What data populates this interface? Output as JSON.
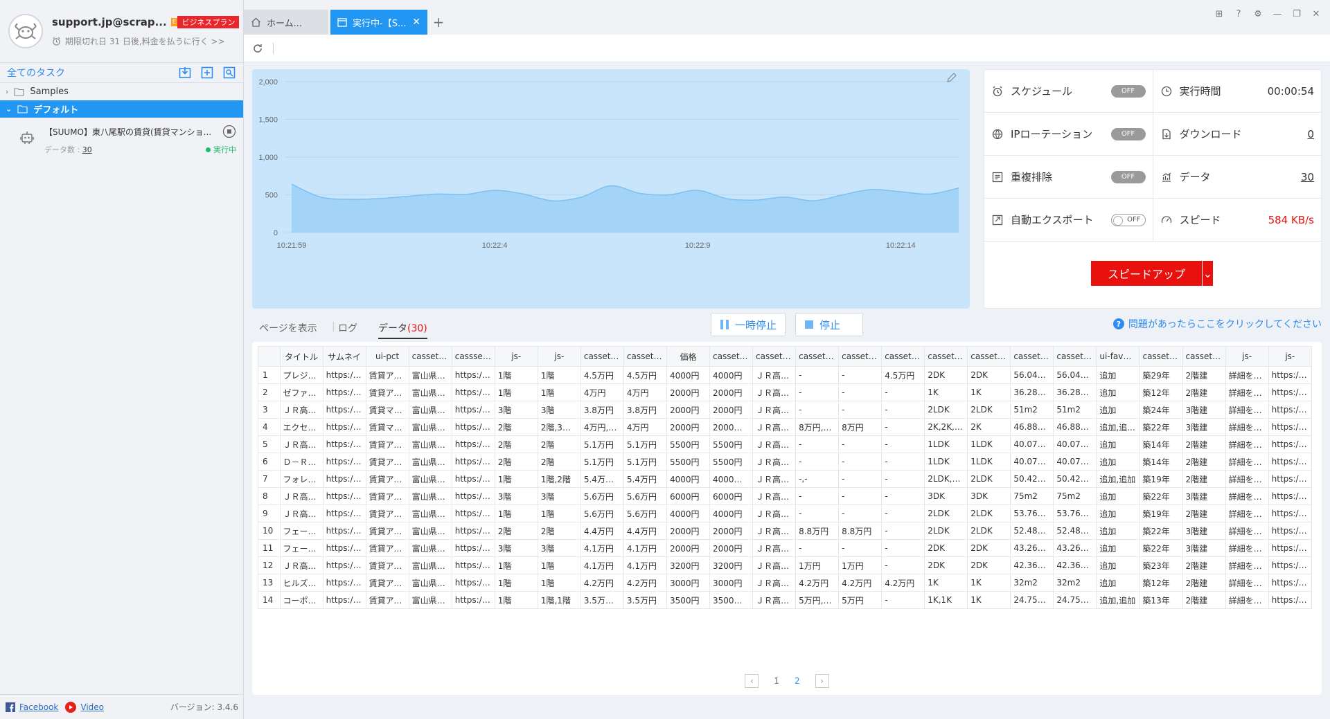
{
  "account": {
    "email": "support.jp@scrap...",
    "plan_badge": "E",
    "plan_label": "ビジネスプラン",
    "expiry_text": "期限切れ日 31 日後,料金を払うに行く >>"
  },
  "sidebar": {
    "all_tasks_label": "全てのタスク",
    "folders": [
      {
        "label": "Samples",
        "expanded": false,
        "selected": false
      },
      {
        "label": "デフォルト",
        "expanded": true,
        "selected": true
      }
    ],
    "task": {
      "title": "【SUUMO】東八尾駅の賃貸(賃貸マンショ...",
      "data_count_label": "データ数 :",
      "data_count": "30",
      "status": "実行中"
    },
    "footer": {
      "facebook": "Facebook",
      "video": "Video",
      "version": "バージョン: 3.4.6"
    }
  },
  "tabs": [
    {
      "label": "ホーム...",
      "active": false
    },
    {
      "label": "実行中-【S...",
      "active": true
    }
  ],
  "window_controls": [
    "gift-icon",
    "help-icon",
    "settings-icon",
    "minimize-icon",
    "restore-icon",
    "close-icon"
  ],
  "chart_data": {
    "type": "area",
    "title": "",
    "xlabel": "",
    "ylabel": "",
    "ylim": [
      0,
      2000
    ],
    "yticks": [
      "0",
      "500",
      "1,000",
      "1,500",
      "2,000"
    ],
    "xticks": [
      "10:21:59",
      "10:22:4",
      "10:22:9",
      "10:22:14"
    ],
    "x": [
      0,
      1,
      2,
      3,
      4,
      5,
      6,
      7,
      8,
      9,
      10,
      11,
      12,
      13,
      14,
      15,
      16,
      17,
      18,
      19,
      20,
      21,
      22,
      23
    ],
    "values": [
      640,
      470,
      440,
      450,
      480,
      510,
      505,
      560,
      510,
      420,
      470,
      620,
      520,
      500,
      560,
      450,
      430,
      470,
      420,
      500,
      570,
      540,
      510,
      590
    ],
    "colors": {
      "fill": "#9fd2f7",
      "line": "#7cc0f2",
      "background": "#c8e5fb"
    }
  },
  "stats": {
    "schedule": {
      "label": "スケジュール",
      "state": "OFF"
    },
    "runtime": {
      "label": "実行時間",
      "value": "00:00:54"
    },
    "ip_rotation": {
      "label": "IPローテーション",
      "state": "OFF"
    },
    "download": {
      "label": "ダウンロード",
      "value": "0"
    },
    "dedupe": {
      "label": "重複排除",
      "state": "OFF"
    },
    "data": {
      "label": "データ",
      "value": "30"
    },
    "auto_export": {
      "label": "自動エクスポート",
      "state": "OFF"
    },
    "speed": {
      "label": "スピード",
      "value": "584 KB/s",
      "color": "#e8110d"
    },
    "speedup_button": "スピードアップ"
  },
  "data_tabs": {
    "show_page": "ページを表示",
    "log": "ログ",
    "data_label": "データ",
    "data_count": "(30)",
    "pause_button": "一時停止",
    "stop_button": "停止",
    "help_text": "問題があったらここをクリックしてください"
  },
  "table": {
    "columns": [
      "",
      "タイトル",
      "サムネイ",
      "ui-pct",
      "cassette...",
      "cassset...",
      "js-",
      "js-",
      "cassette...",
      "cassette...",
      "価格",
      "cassette...",
      "cassette...",
      "cassette...",
      "cassette...",
      "cassette...",
      "cassette...",
      "cassette...",
      "cassette...",
      "cassette...",
      "ui-favorite",
      "cassette...",
      "cassette...",
      "js-",
      "js-"
    ],
    "rows": [
      [
        "1",
        "プレジー...",
        "https://im...",
        "賃貸アパ...",
        "富山県富...",
        "https://im...",
        "1階",
        "1階",
        "4.5万円",
        "4.5万円",
        "4000円",
        "4000円",
        "ＪＲ高山...",
        "-",
        "-",
        "4.5万円",
        "2DK",
        "2DK",
        "56.04m2",
        "56.04m2",
        "追加",
        "築29年",
        "2階建",
        "詳細を見...",
        "https://su..."
      ],
      [
        "2",
        "ゼファー...",
        "https://im...",
        "賃貸アパ...",
        "富山県富...",
        "https://im...",
        "1階",
        "1階",
        "4万円",
        "4万円",
        "2000円",
        "2000円",
        "ＪＲ高山...",
        "-",
        "-",
        "-",
        "1K",
        "1K",
        "36.28m2",
        "36.28m2",
        "追加",
        "築12年",
        "2階建",
        "詳細を見...",
        "https://su..."
      ],
      [
        "3",
        "ＪＲ高山...",
        "https://im...",
        "賃貸マン...",
        "富山県富...",
        "https://im...",
        "3階",
        "3階",
        "3.8万円",
        "3.8万円",
        "2000円",
        "2000円",
        "ＪＲ高山...",
        "-",
        "-",
        "-",
        "2LDK",
        "2LDK",
        "51m2",
        "51m2",
        "追加",
        "築24年",
        "3階建",
        "詳細を見...",
        "https://su..."
      ],
      [
        "4",
        "エクセル...",
        "https://im...",
        "賃貸マン...",
        "富山県富...",
        "https://im...",
        "2階",
        "2階,3階,...",
        "4万円,4....",
        "4万円",
        "2000円",
        "2000円,...",
        "ＪＲ高山...",
        "8万円,8....",
        "8万円",
        "-",
        "2K,2K,2...",
        "2K",
        "46.88m2,...",
        "46.88m2",
        "追加,追...",
        "築22年",
        "3階建",
        "詳細を見...",
        "https://su..."
      ],
      [
        "5",
        "ＪＲ高山...",
        "https://im...",
        "賃貸アパ...",
        "富山県富...",
        "https://im...",
        "2階",
        "2階",
        "5.1万円",
        "5.1万円",
        "5500円",
        "5500円",
        "ＪＲ高山...",
        "-",
        "-",
        "-",
        "1LDK",
        "1LDK",
        "40.07m2",
        "40.07m2",
        "追加",
        "築14年",
        "2階建",
        "詳細を見...",
        "https://su..."
      ],
      [
        "6",
        "Ｄ－Ｒｏ...",
        "https://im...",
        "賃貸アパ...",
        "富山県富...",
        "https://im...",
        "2階",
        "2階",
        "5.1万円",
        "5.1万円",
        "5500円",
        "5500円",
        "ＪＲ高山...",
        "-",
        "-",
        "-",
        "1LDK",
        "1LDK",
        "40.07m2",
        "40.07m2",
        "追加",
        "築14年",
        "2階建",
        "詳細を見...",
        "https://su..."
      ],
      [
        "7",
        "フォレス...",
        "https://im...",
        "賃貸アパ...",
        "富山県富...",
        "https://im...",
        "1階",
        "1階,2階",
        "5.4万円,...",
        "5.4万円",
        "4000円",
        "4000円,...",
        "ＪＲ高山...",
        "-,-",
        "-",
        "-",
        "2LDK,2...",
        "2LDK",
        "50.42m2...",
        "50.42m2",
        "追加,追加",
        "築19年",
        "2階建",
        "詳細を見...",
        "https://su..."
      ],
      [
        "8",
        "ＪＲ高山...",
        "https://im...",
        "賃貸アパ...",
        "富山県富...",
        "https://im...",
        "3階",
        "3階",
        "5.6万円",
        "5.6万円",
        "6000円",
        "6000円",
        "ＪＲ高山...",
        "-",
        "-",
        "-",
        "3DK",
        "3DK",
        "75m2",
        "75m2",
        "追加",
        "築22年",
        "3階建",
        "詳細を見...",
        "https://su..."
      ],
      [
        "9",
        "ＪＲ高山...",
        "https://im...",
        "賃貸アパ...",
        "富山県富...",
        "https://im...",
        "1階",
        "1階",
        "5.6万円",
        "5.6万円",
        "4000円",
        "4000円",
        "ＪＲ高山...",
        "-",
        "-",
        "-",
        "2LDK",
        "2LDK",
        "53.76m2",
        "53.76m2",
        "追加",
        "築19年",
        "2階建",
        "詳細を見...",
        "https://su..."
      ],
      [
        "10",
        "フェール...",
        "https://im...",
        "賃貸アパ...",
        "富山県富...",
        "https://im...",
        "2階",
        "2階",
        "4.4万円",
        "4.4万円",
        "2000円",
        "2000円",
        "ＪＲ高山...",
        "8.8万円",
        "8.8万円",
        "-",
        "2LDK",
        "2LDK",
        "52.48m2",
        "52.48m2",
        "追加",
        "築22年",
        "3階建",
        "詳細を見...",
        "https://su..."
      ],
      [
        "11",
        "フェール...",
        "https://im...",
        "賃貸アパ...",
        "富山県富...",
        "https://im...",
        "3階",
        "3階",
        "4.1万円",
        "4.1万円",
        "2000円",
        "2000円",
        "ＪＲ高山...",
        "-",
        "-",
        "-",
        "2DK",
        "2DK",
        "43.26m2",
        "43.26m2",
        "追加",
        "築22年",
        "3階建",
        "詳細を見...",
        "https://su..."
      ],
      [
        "12",
        "ＪＲ高山...",
        "https://im...",
        "賃貸アパ...",
        "富山県富...",
        "https://im...",
        "1階",
        "1階",
        "4.1万円",
        "4.1万円",
        "3200円",
        "3200円",
        "ＪＲ高山...",
        "1万円",
        "1万円",
        "-",
        "2DK",
        "2DK",
        "42.36m2",
        "42.36m2",
        "追加",
        "築23年",
        "2階建",
        "詳細を見...",
        "https://su..."
      ],
      [
        "13",
        "ヒルズ杉...",
        "https://im...",
        "賃貸アパ...",
        "富山県富...",
        "https://im...",
        "1階",
        "1階",
        "4.2万円",
        "4.2万円",
        "3000円",
        "3000円",
        "ＪＲ高山...",
        "4.2万円",
        "4.2万円",
        "4.2万円",
        "1K",
        "1K",
        "32m2",
        "32m2",
        "追加",
        "築12年",
        "2階建",
        "詳細を見...",
        "https://su..."
      ],
      [
        "14",
        "コーポ・...",
        "https://im...",
        "賃貸アパ...",
        "富山県富...",
        "https://im...",
        "1階",
        "1階,1階",
        "3.5万円,...",
        "3.5万円",
        "3500円",
        "3500円,...",
        "ＪＲ高山...",
        "5万円,5....",
        "5万円",
        "-",
        "1K,1K",
        "1K",
        "24.75m2...",
        "24.75m2",
        "追加,追加",
        "築13年",
        "2階建",
        "詳細を見...",
        "https://su..."
      ]
    ]
  },
  "pagination": {
    "pages": [
      "1",
      "2"
    ],
    "current": "2"
  }
}
